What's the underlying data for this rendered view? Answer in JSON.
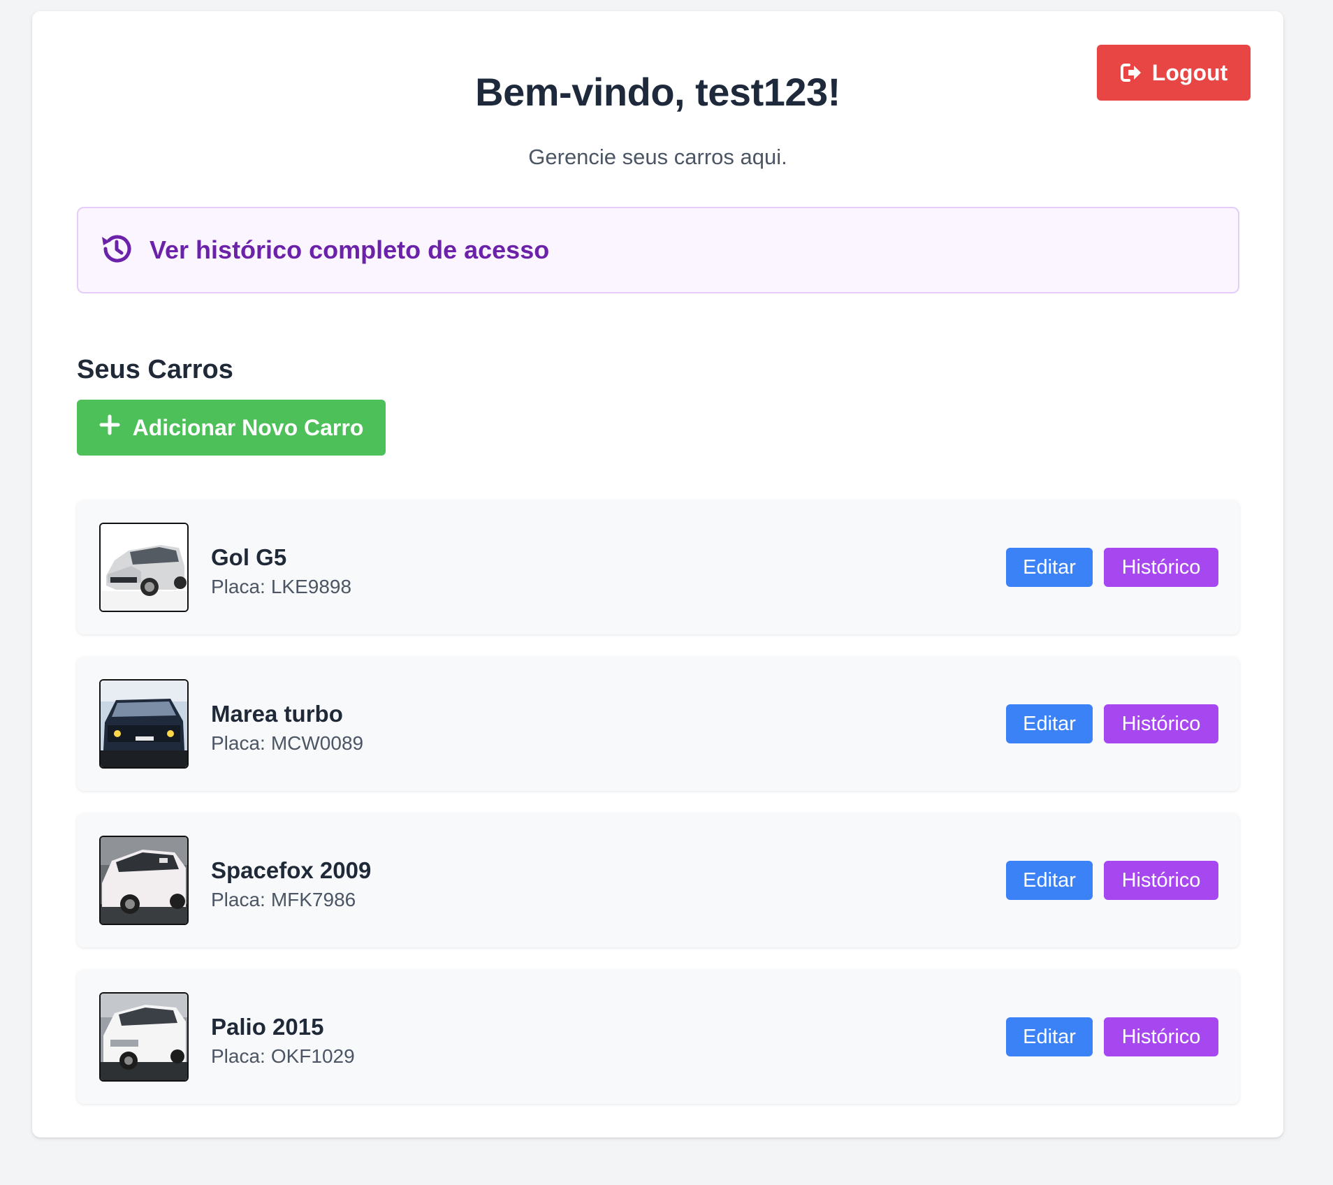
{
  "header": {
    "title": "Bem-vindo, test123!",
    "subtitle": "Gerencie seus carros aqui.",
    "logout_label": "Logout",
    "logout_icon": "sign-out-icon"
  },
  "history_link": {
    "label": "Ver histórico completo de acesso",
    "icon": "history-clock-icon"
  },
  "cars_section": {
    "title": "Seus Carros",
    "add_button_label": "Adicionar Novo Carro",
    "add_icon": "plus-icon",
    "plate_label": "Placa:",
    "edit_label": "Editar",
    "history_label": "Histórico",
    "cars": [
      {
        "name": "Gol G5",
        "plate": "LKE9898"
      },
      {
        "name": "Marea turbo",
        "plate": "MCW0089"
      },
      {
        "name": "Spacefox 2009",
        "plate": "MFK7986"
      },
      {
        "name": "Palio 2015",
        "plate": "OKF1029"
      }
    ]
  },
  "colors": {
    "logout": "#e84545",
    "add": "#4ec05a",
    "edit": "#3b82f6",
    "history": "#a747f0",
    "history_link_text": "#6b21a8",
    "banner_bg": "#faf5ff"
  }
}
